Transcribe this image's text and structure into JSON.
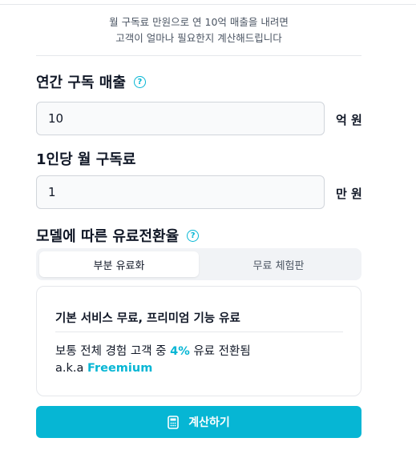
{
  "intro": {
    "line1": "월 구독료 만원으로 연 10억 매출을 내려면",
    "line2": "고객이 얼마나 필요한지 계산해드립니다"
  },
  "annual_revenue": {
    "label": "연간 구독 매출",
    "value": "10",
    "unit": "억 원"
  },
  "monthly_fee": {
    "label": "1인당 월 구독료",
    "value": "1",
    "unit": "만 원"
  },
  "conversion": {
    "label": "모델에 따른 유료전환율",
    "tabs": [
      {
        "label": "부분 유료화",
        "active": true
      },
      {
        "label": "무료 체험판",
        "active": false
      }
    ]
  },
  "card": {
    "title": "기본 서비스 무료, 프리미엄 기능 유료",
    "line1_prefix": "보통 전체 경험 고객 중",
    "line1_rate": "4%",
    "line1_suffix": "유료 전환됨",
    "line2_prefix": "a.k.a",
    "line2_term": "Freemium"
  },
  "calculate_button": {
    "label": "계산하기"
  },
  "colors": {
    "accent": "#06b6d4",
    "border": "#d1d5db",
    "field_bg": "#f9fafb"
  },
  "icons": {
    "help": "question-circle-icon",
    "calculator": "calculator-icon"
  }
}
